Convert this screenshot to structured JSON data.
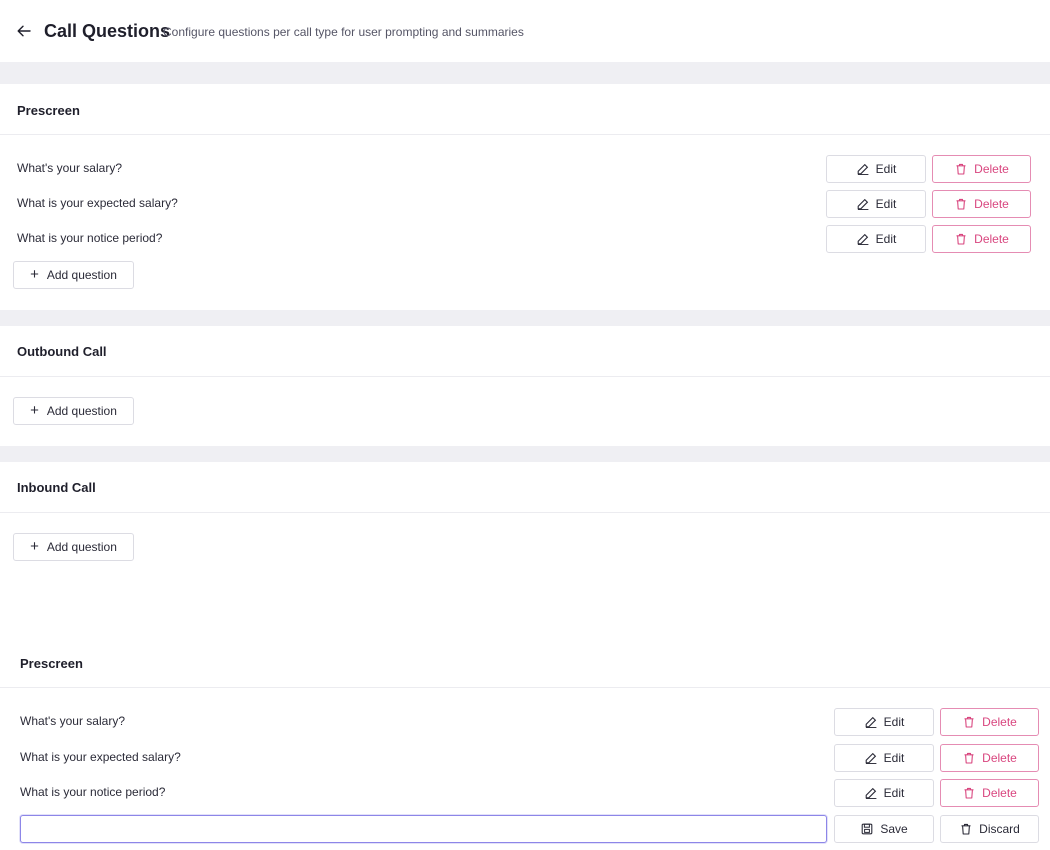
{
  "header": {
    "title": "Call Questions",
    "subtitle": "Configure questions per call type for user prompting and summaries"
  },
  "sections": [
    {
      "title": "Prescreen",
      "questions": [
        "What's your salary?",
        "What is your expected salary?",
        "What is your notice period?"
      ]
    },
    {
      "title": "Outbound Call",
      "questions": []
    },
    {
      "title": "Inbound Call",
      "questions": []
    }
  ],
  "edit_panel": {
    "title": "Prescreen",
    "questions": [
      "What's your salary?",
      "What is your expected salary?",
      "What is your notice period?"
    ],
    "new_question_value": ""
  },
  "labels": {
    "edit": "Edit",
    "delete": "Delete",
    "add_question": "Add question",
    "save": "Save",
    "discard": "Discard"
  },
  "colors": {
    "accent_delete": "#d9467f",
    "input_focus": "#8d86e8",
    "section_gap": "#efeff3"
  },
  "icons": {
    "back": "arrow-left-icon",
    "edit": "pencil-icon",
    "delete": "trash-icon",
    "add": "plus-icon",
    "save": "save-icon",
    "discard": "trash-icon"
  }
}
